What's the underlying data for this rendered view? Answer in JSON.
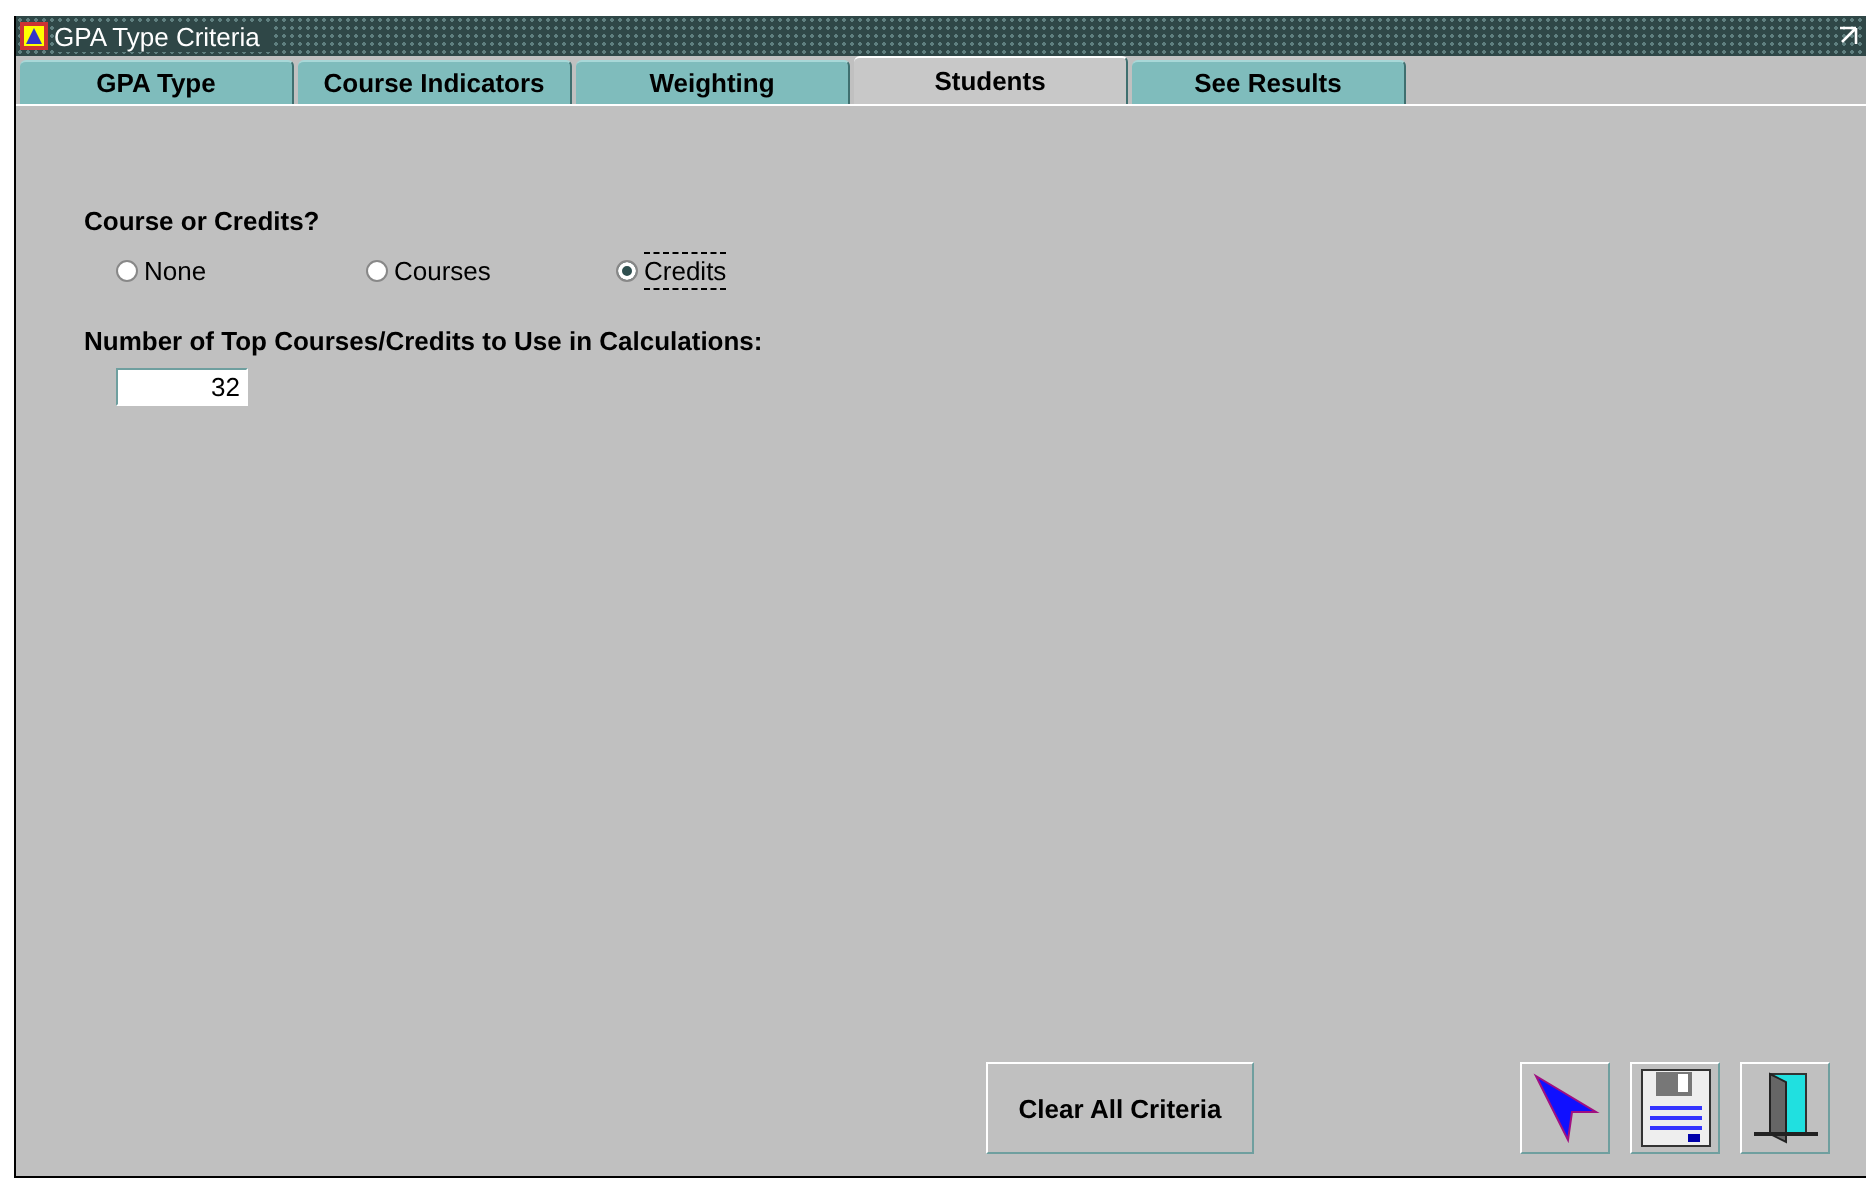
{
  "window": {
    "title": "GPA Type Criteria"
  },
  "tabs": [
    {
      "label": "GPA Type",
      "selected": false
    },
    {
      "label": "Course Indicators",
      "selected": false
    },
    {
      "label": "Weighting",
      "selected": false
    },
    {
      "label": "Students",
      "selected": true
    },
    {
      "label": "See Results",
      "selected": false
    }
  ],
  "course_or_credits": {
    "label": "Course or Credits?",
    "options": [
      {
        "label": "None",
        "selected": false
      },
      {
        "label": "Courses",
        "selected": false
      },
      {
        "label": "Credits",
        "selected": true
      }
    ]
  },
  "top_count": {
    "label": "Number of Top Courses/Credits to Use in Calculations:",
    "value": "32"
  },
  "clear_button": "Clear All Criteria"
}
